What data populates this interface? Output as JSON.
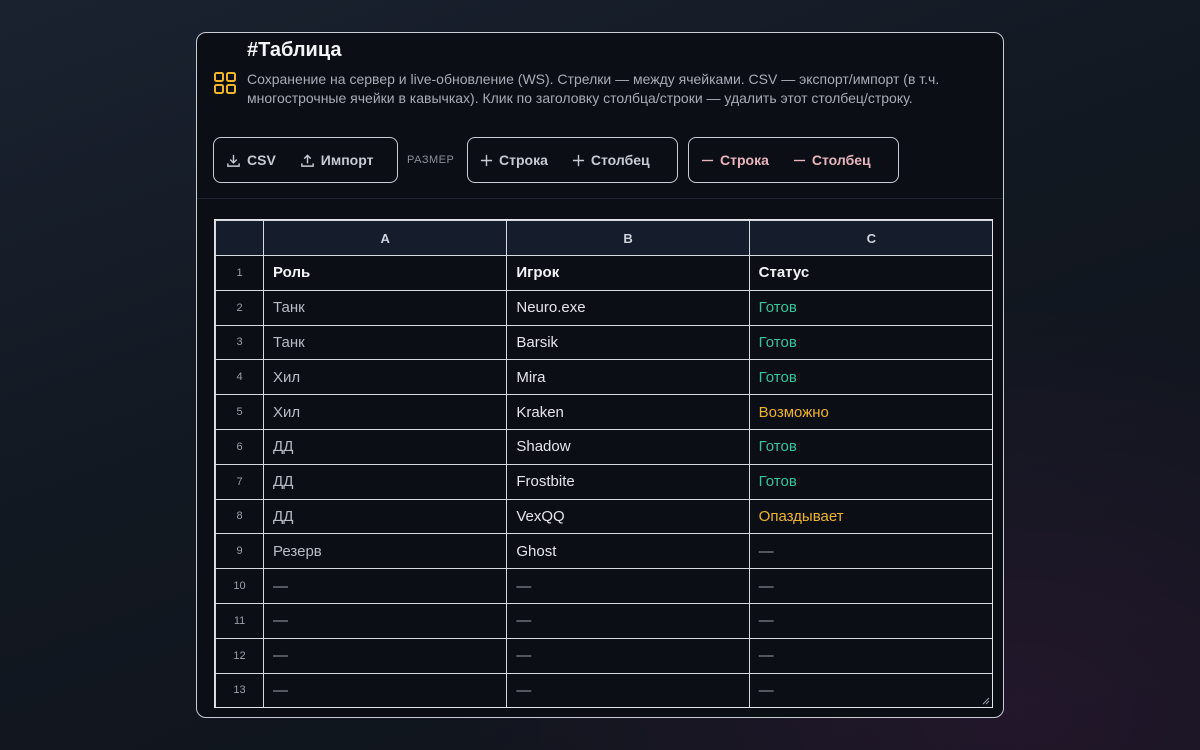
{
  "header": {
    "title": "#Таблица",
    "description": "Сохранение на сервер и live-обновление (WS). Стрелки — между ячейками. CSV — экспорт/импорт (в т.ч. многострочные ячейки в кавычках). Клик по заголовку столбца/строки — удалить этот столбец/строку.",
    "icon": "grid-icon",
    "accent": "#f0b429"
  },
  "toolbar": {
    "csv_label": "CSV",
    "import_label": "Импорт",
    "size_label": "РАЗМЕР",
    "add_row_label": "Строка",
    "add_col_label": "Столбец",
    "remove_row_label": "Строка",
    "remove_col_label": "Столбец"
  },
  "table": {
    "columns": [
      "A",
      "B",
      "C"
    ],
    "rows": [
      {
        "num": "1",
        "cells": [
          "Роль",
          "Игрок",
          "Статус"
        ]
      },
      {
        "num": "2",
        "cells": [
          "Танк",
          "Neuro.exe",
          "Готов"
        ]
      },
      {
        "num": "3",
        "cells": [
          "Танк",
          "Barsik",
          "Готов"
        ]
      },
      {
        "num": "4",
        "cells": [
          "Хил",
          "Mira",
          "Готов"
        ]
      },
      {
        "num": "5",
        "cells": [
          "Хил",
          "Kraken",
          "Возможно"
        ]
      },
      {
        "num": "6",
        "cells": [
          "ДД",
          "Shadow",
          "Готов"
        ]
      },
      {
        "num": "7",
        "cells": [
          "ДД",
          "Frostbite",
          "Готов"
        ]
      },
      {
        "num": "8",
        "cells": [
          "ДД",
          "VexQQ",
          "Опаздывает"
        ]
      },
      {
        "num": "9",
        "cells": [
          "Резерв",
          "Ghost",
          "—"
        ]
      },
      {
        "num": "10",
        "cells": [
          "—",
          "—",
          "—"
        ]
      },
      {
        "num": "11",
        "cells": [
          "—",
          "—",
          "—"
        ]
      },
      {
        "num": "12",
        "cells": [
          "—",
          "—",
          "—"
        ]
      },
      {
        "num": "13",
        "cells": [
          "—",
          "—",
          "—"
        ]
      }
    ],
    "status_colors": {
      "ready": "#37c598",
      "maybe": "#f0b429",
      "late": "#f0b429"
    }
  }
}
